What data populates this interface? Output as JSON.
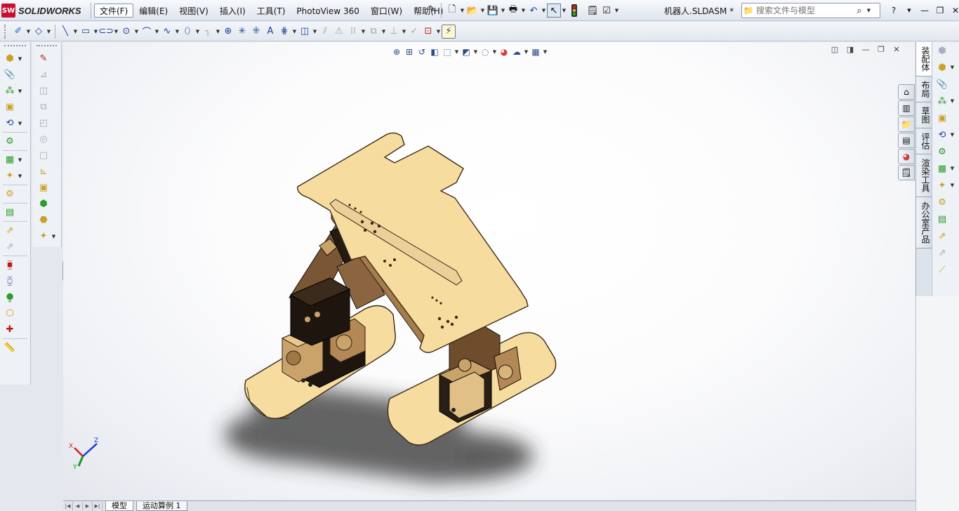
{
  "app": {
    "brand": "SOLIDWORKS",
    "logo_mark": "SW"
  },
  "menus": [
    {
      "label": "文件(F)",
      "active": true
    },
    {
      "label": "编辑(E)"
    },
    {
      "label": "视图(V)"
    },
    {
      "label": "插入(I)"
    },
    {
      "label": "工具(T)"
    },
    {
      "label": "PhotoView 360"
    },
    {
      "label": "窗口(W)"
    },
    {
      "label": "帮助(H)"
    }
  ],
  "document": {
    "title": "机器人.SLDASM *"
  },
  "search": {
    "placeholder": "搜索文件与模型"
  },
  "bottom_tabs": [
    {
      "label": "模型",
      "active": true
    },
    {
      "label": "运动算例 1"
    }
  ],
  "taskpane_tabs": [
    {
      "label": "装配体",
      "active": true
    },
    {
      "label": "布局"
    },
    {
      "label": "草图"
    },
    {
      "label": "评估"
    },
    {
      "label": "渲染工具"
    },
    {
      "label": "办公室产品"
    }
  ],
  "triad": {
    "x": "X",
    "y": "Y",
    "z": "Z"
  },
  "colors": {
    "part_tan": "#f7dca0",
    "part_edge": "#3b2a14",
    "bracket_dark": "#2a1f14",
    "shadow": "#3a3a3a"
  }
}
